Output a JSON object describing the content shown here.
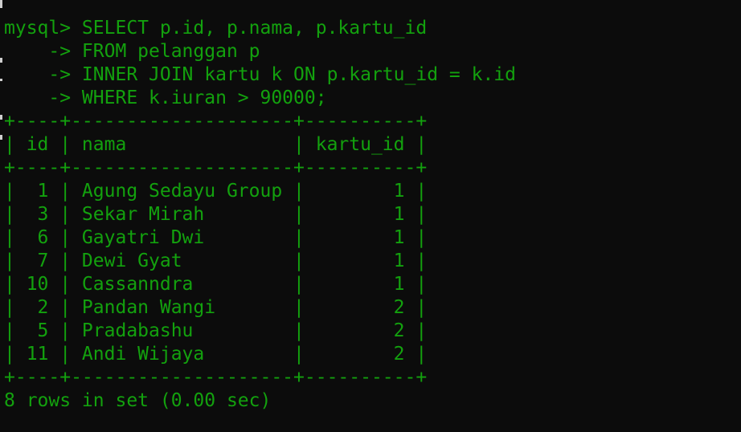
{
  "terminal": {
    "lines": [
      "mysql> SELECT p.id, p.nama, p.kartu_id",
      "    -> FROM pelanggan p",
      "    -> INNER JOIN kartu k ON p.kartu_id = k.id",
      "    -> WHERE k.iuran > 90000;",
      "+----+--------------------+----------+",
      "| id | nama               | kartu_id |",
      "+----+--------------------+----------+",
      "|  1 | Agung Sedayu Group |        1 |",
      "|  3 | Sekar Mirah        |        1 |",
      "|  6 | Gayatri Dwi        |        1 |",
      "|  7 | Dewi Gyat          |        1 |",
      "| 10 | Cassanndra         |        1 |",
      "|  2 | Pandan Wangi       |        2 |",
      "|  5 | Pradabashu         |        2 |",
      "| 11 | Andi Wijaya        |        2 |",
      "+----+--------------------+----------+",
      "8 rows in set (0.00 sec)"
    ]
  },
  "colors": {
    "background": "#0c0c0c",
    "text": "#13a10e"
  }
}
